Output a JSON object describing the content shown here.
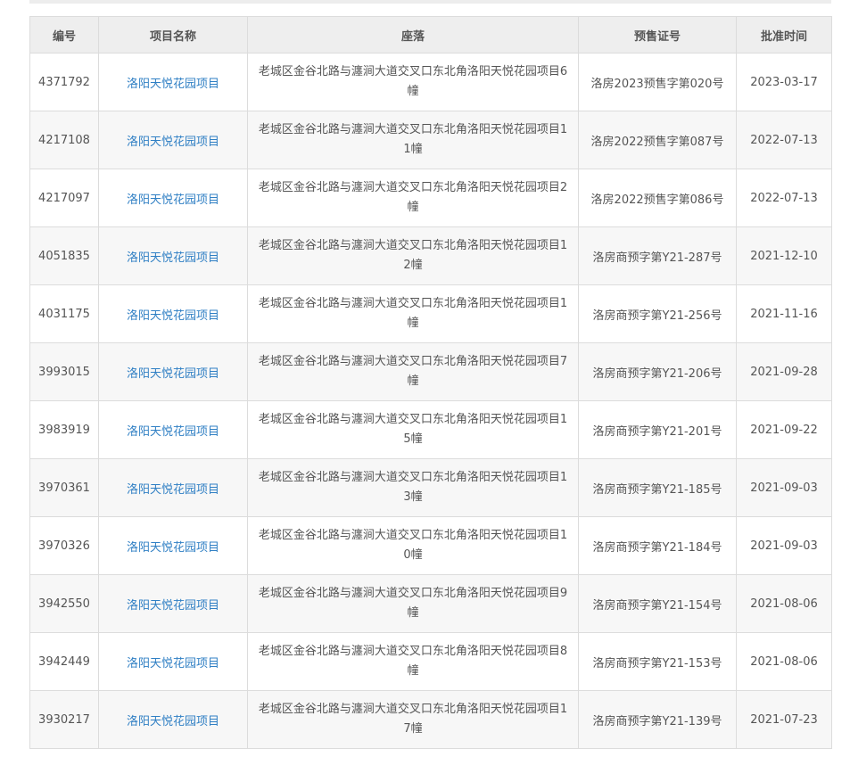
{
  "table": {
    "headers": [
      "编号",
      "项目名称",
      "座落",
      "预售证号",
      "批准时间"
    ],
    "rows": [
      {
        "id": "4371792",
        "name": "洛阳天悦花园项目",
        "location": "老城区金谷北路与瀍涧大道交叉口东北角洛阳天悦花园项目6幢",
        "permit": "洛房2023预售字第020号",
        "date": "2023-03-17"
      },
      {
        "id": "4217108",
        "name": "洛阳天悦花园项目",
        "location": "老城区金谷北路与瀍涧大道交叉口东北角洛阳天悦花园项目11幢",
        "permit": "洛房2022预售字第087号",
        "date": "2022-07-13"
      },
      {
        "id": "4217097",
        "name": "洛阳天悦花园项目",
        "location": "老城区金谷北路与瀍涧大道交叉口东北角洛阳天悦花园项目2幢",
        "permit": "洛房2022预售字第086号",
        "date": "2022-07-13"
      },
      {
        "id": "4051835",
        "name": "洛阳天悦花园项目",
        "location": "老城区金谷北路与瀍涧大道交叉口东北角洛阳天悦花园项目12幢",
        "permit": "洛房商预字第Y21-287号",
        "date": "2021-12-10"
      },
      {
        "id": "4031175",
        "name": "洛阳天悦花园项目",
        "location": "老城区金谷北路与瀍涧大道交叉口东北角洛阳天悦花园项目1幢",
        "permit": "洛房商预字第Y21-256号",
        "date": "2021-11-16"
      },
      {
        "id": "3993015",
        "name": "洛阳天悦花园项目",
        "location": "老城区金谷北路与瀍涧大道交叉口东北角洛阳天悦花园项目7幢",
        "permit": "洛房商预字第Y21-206号",
        "date": "2021-09-28"
      },
      {
        "id": "3983919",
        "name": "洛阳天悦花园项目",
        "location": "老城区金谷北路与瀍涧大道交叉口东北角洛阳天悦花园项目15幢",
        "permit": "洛房商预字第Y21-201号",
        "date": "2021-09-22"
      },
      {
        "id": "3970361",
        "name": "洛阳天悦花园项目",
        "location": "老城区金谷北路与瀍涧大道交叉口东北角洛阳天悦花园项目13幢",
        "permit": "洛房商预字第Y21-185号",
        "date": "2021-09-03"
      },
      {
        "id": "3970326",
        "name": "洛阳天悦花园项目",
        "location": "老城区金谷北路与瀍涧大道交叉口东北角洛阳天悦花园项目10幢",
        "permit": "洛房商预字第Y21-184号",
        "date": "2021-09-03"
      },
      {
        "id": "3942550",
        "name": "洛阳天悦花园项目",
        "location": "老城区金谷北路与瀍涧大道交叉口东北角洛阳天悦花园项目9幢",
        "permit": "洛房商预字第Y21-154号",
        "date": "2021-08-06"
      },
      {
        "id": "3942449",
        "name": "洛阳天悦花园项目",
        "location": "老城区金谷北路与瀍涧大道交叉口东北角洛阳天悦花园项目8幢",
        "permit": "洛房商预字第Y21-153号",
        "date": "2021-08-06"
      },
      {
        "id": "3930217",
        "name": "洛阳天悦花园项目",
        "location": "老城区金谷北路与瀍涧大道交叉口东北角洛阳天悦花园项目17幢",
        "permit": "洛房商预字第Y21-139号",
        "date": "2021-07-23"
      }
    ]
  },
  "colors": {
    "link": "#2f7fc4",
    "header_bg": "#eeeeee",
    "border": "#dcdcdc",
    "stripe": "#f7f7f7"
  }
}
